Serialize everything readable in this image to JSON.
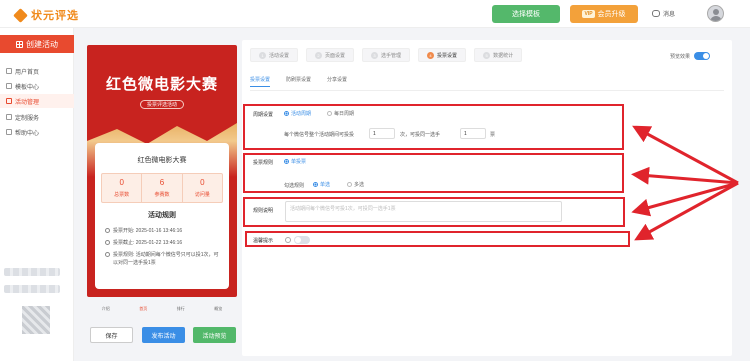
{
  "header": {
    "logo_text": "状元评选",
    "select_template": "选择模板",
    "vip_badge": "VIP",
    "upgrade": "会员升级",
    "messages": "消息"
  },
  "sidebar": {
    "create": "创建活动",
    "items": [
      {
        "label": "用户首页",
        "active": false
      },
      {
        "label": "模板中心",
        "active": false
      },
      {
        "label": "活动管理",
        "active": true
      },
      {
        "label": "定制服务",
        "active": false
      },
      {
        "label": "帮助中心",
        "active": false
      }
    ]
  },
  "preview": {
    "title": "红色微电影大赛",
    "tag": "投票评选活动",
    "card_title": "红色微电影大赛",
    "stats": [
      {
        "num": "0",
        "label": "总票数"
      },
      {
        "num": "6",
        "label": "参赛数"
      },
      {
        "num": "0",
        "label": "访问量"
      }
    ],
    "rules_title": "活动规则",
    "rules": [
      "投票开始: 2025-01-16 13:46:16",
      "投票截止: 2025-01-22 13:46:16",
      "投票规则: 活动期间每个微信号只可以投1次，可以对同一选手投1票"
    ],
    "tabs": [
      "介绍",
      "首页",
      "排行",
      "概览"
    ],
    "active_tab": 1
  },
  "actions": {
    "save": "保存",
    "publish": "发布活动",
    "preview": "活动预览"
  },
  "settings": {
    "steps": [
      {
        "num": "1",
        "label": "活动设置"
      },
      {
        "num": "2",
        "label": "页面设置"
      },
      {
        "num": "3",
        "label": "选手管理"
      },
      {
        "num": "4",
        "label": "投票设置"
      },
      {
        "num": "5",
        "label": "数据统计"
      }
    ],
    "active_step": 3,
    "preview_toggle": "预览效果",
    "subtabs": [
      "投票设置",
      "防刷票设置",
      "分享设置"
    ],
    "period": {
      "label": "周期设置",
      "options": [
        "活动周期",
        "每日周期"
      ],
      "sentence_a": "每个微信号整个活动期间可投投",
      "value1": "1",
      "sentence_b": "次，可投同一选手",
      "value2": "1",
      "sentence_c": "票"
    },
    "rule": {
      "label": "投票规则",
      "option": "单投票",
      "select_label": "勾选规则",
      "select_options": [
        "单选",
        "多选"
      ]
    },
    "desc": {
      "label": "规则说明",
      "placeholder": "活动期间每个微信号可投1次，可投同一选手1票"
    },
    "tip": {
      "label": "温馨提示"
    }
  }
}
